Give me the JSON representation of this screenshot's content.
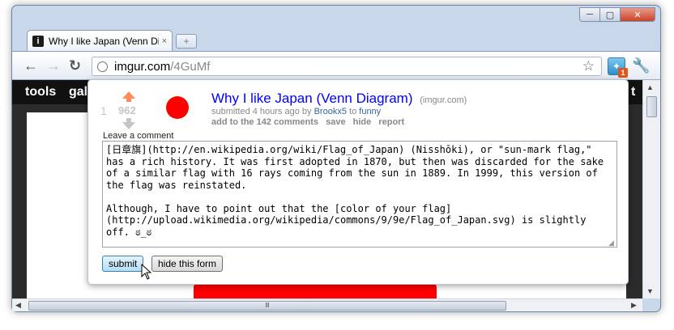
{
  "window": {
    "controls": {
      "minimize": "─",
      "maximize": "▢",
      "close": "✕"
    }
  },
  "tab": {
    "favicon": "i",
    "title": "Why I like Japan (Venn Diag",
    "close": "×",
    "new_tab": "+"
  },
  "toolbar": {
    "back": "←",
    "forward": "→",
    "reload": "↻",
    "url_host": "imgur.com",
    "url_path": "/4GuMf",
    "star": "☆",
    "extension_badge": "1",
    "wrench": "🔧"
  },
  "site": {
    "header_items": [
      "tools",
      "gal",
      "t"
    ]
  },
  "post": {
    "rank": "1",
    "score": "962",
    "title": "Why I like Japan (Venn Diagram)",
    "domain": "(imgur.com)",
    "meta_prefix": "submitted 4 hours ago by",
    "author": "Brookx5",
    "meta_to": "to",
    "subreddit": "funny",
    "actions": [
      "add to the 142 comments",
      "save",
      "hide",
      "report"
    ]
  },
  "comment": {
    "label": "Leave a comment",
    "text": "[日章旗](http://en.wikipedia.org/wiki/Flag_of_Japan) (Nisshōki), or \"sun-mark flag,\" has a rich history. It was first adopted in 1870, but then was discarded for the sake of a similar flag with 16 rays coming from the sun in 1889. In 1999, this version of the flag was reinstated.\n\nAlthough, I have to point out that the [color of your flag](http://upload.wikimedia.org/wikipedia/commons/9/9e/Flag_of_Japan.svg) is slightly off. ಠ_ಠ",
    "submit_label": "submit",
    "hide_label": "hide this form"
  },
  "scrollbars": {
    "up": "▲",
    "down": "▼",
    "left": "◀",
    "right": "▶",
    "grip": "Ⅲ"
  }
}
